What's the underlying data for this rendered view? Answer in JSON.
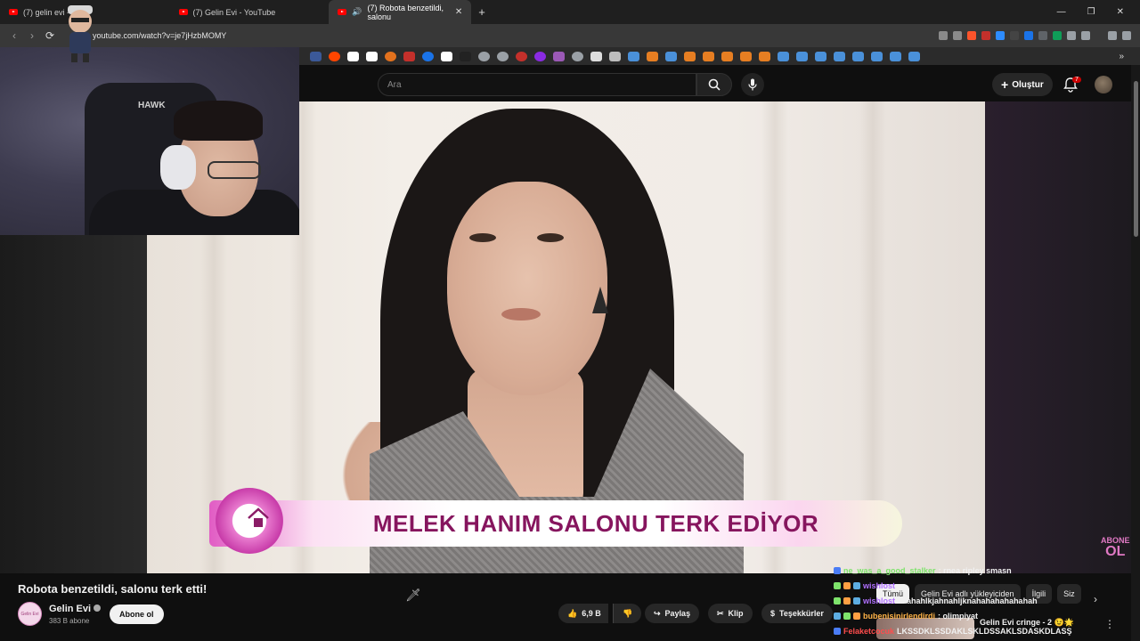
{
  "browser": {
    "tabs": [
      {
        "title": "(7) gelin evi - Yo"
      },
      {
        "title": "(7) Gelin Evi - YouTube"
      },
      {
        "title": "(7) Robota benzetildi, salonu"
      }
    ],
    "url": "youtube.com/watch?v=je7jHzbMOMY"
  },
  "youtube": {
    "search_placeholder": "Ara",
    "create_label": "Oluştur",
    "notif_count": "7"
  },
  "video": {
    "banner_text": "MELEK HANIM SALONU TERK EDİYOR",
    "corner_line1": "ABONE",
    "corner_line2": "OL",
    "title": "Robota benzetildi, salonu terk etti!",
    "channel_avatar_text": "Gelin Evi",
    "channel_name": "Gelin Evi",
    "subscribers": "383 B abone",
    "subscribe_label": "Abone ol",
    "likes": "6,9 B",
    "share_label": "Paylaş",
    "clip_label": "Klip",
    "thanks_label": "Teşekkürler"
  },
  "webcam": {
    "chair_brand": "HAWK"
  },
  "chat": [
    {
      "user": "ne_was_a_good_stalker",
      "user_color": "#7ee36b",
      "message": ": rnea ripley smasn"
    },
    {
      "user": "wishlost",
      "user_color": "#b070ff",
      "message": ":"
    },
    {
      "user": "wishlost",
      "user_color": "#b070ff",
      "message": "aaahahlkjahnahljknahahahahahahah"
    },
    {
      "user": "bubenisinirlendirdi",
      "user_color": "#ffb347",
      "message": ": olimpiyat"
    },
    {
      "user": "Felaketcocuk",
      "user_color": "#ff4d4d",
      "message": "LKSSDKLSSDAKLSKLDSSAKLSDASKDLASŞ"
    }
  ],
  "recommendations": {
    "chips": [
      "Tümü",
      "Gelin Evi adlı yükleyiciden",
      "İlgili",
      "Siz"
    ],
    "first_title": "Gelin Evi cringe - 2 😉🌟"
  }
}
